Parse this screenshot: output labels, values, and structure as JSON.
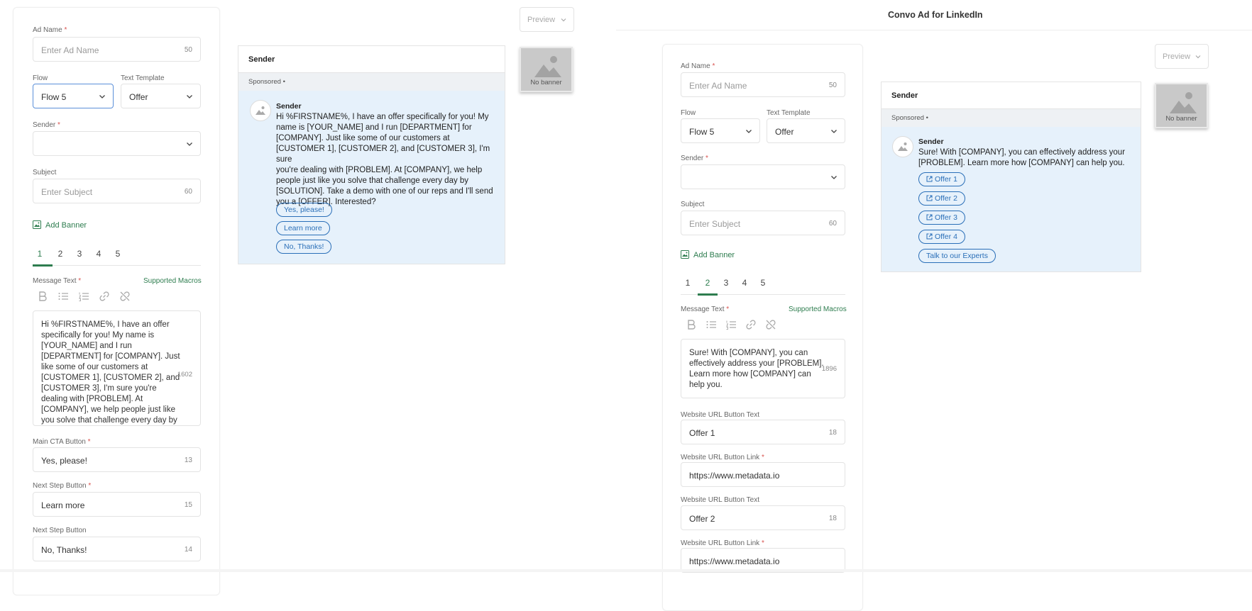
{
  "left_form": {
    "ad_name": {
      "label": "Ad Name",
      "required": "*",
      "placeholder": "Enter Ad Name",
      "count": "50"
    },
    "flow": {
      "label": "Flow",
      "value": "Flow 5"
    },
    "text_template": {
      "label": "Text Template",
      "value": "Offer"
    },
    "sender": {
      "label": "Sender",
      "required": "*",
      "value": ""
    },
    "subject": {
      "label": "Subject",
      "placeholder": "Enter Subject",
      "count": "60"
    },
    "add_banner": "Add Banner",
    "tabs": [
      "1",
      "2",
      "3",
      "4",
      "5"
    ],
    "active_tab": "1",
    "message_text": {
      "label": "Message Text",
      "required": "*",
      "macros": "Supported Macros",
      "count": "1602",
      "lines": [
        "Hi %FIRSTNAME%, I have an offer",
        "specifically for you! My name is",
        "[YOUR_NAME] and I run",
        "[DEPARTMENT] for [COMPANY]. Just",
        "like some of our customers at",
        "[CUSTOMER 1], [CUSTOMER 2], and",
        "[CUSTOMER 3], I'm sure you're",
        "dealing with [PROBLEM]. At",
        "[COMPANY], we help people just like",
        "you solve that challenge every day by"
      ]
    },
    "main_cta": {
      "label": "Main CTA Button",
      "required": "*",
      "value": "Yes, please!",
      "count": "13"
    },
    "next_step_1": {
      "label": "Next Step Button",
      "required": "*",
      "value": "Learn more",
      "count": "15"
    },
    "next_step_2": {
      "label": "Next Step Button",
      "value": "No, Thanks!",
      "count": "14"
    }
  },
  "left_preview": {
    "preview_label": "Preview",
    "sender_header": "Sender",
    "sponsored": "Sponsored •",
    "sender_name": "Sender",
    "message_lines": [
      "Hi %FIRSTNAME%, I have an offer specifically for you! My",
      "name is [YOUR_NAME] and I run [DEPARTMENT] for",
      "[COMPANY]. Just like some of our customers at",
      "[CUSTOMER 1], [CUSTOMER 2], and [CUSTOMER 3], I'm sure",
      "you're dealing with [PROBLEM]. At [COMPANY], we help",
      "people just like you solve that challenge every day by",
      "[SOLUTION]. Take a demo with one of our reps and I'll send",
      "you a [OFFER]. Interested?"
    ],
    "buttons": [
      "Yes, please!",
      "Learn more",
      "No, Thanks!"
    ],
    "banner_text": "No banner"
  },
  "right_title": "Convo Ad for LinkedIn",
  "right_form": {
    "ad_name": {
      "label": "Ad Name",
      "required": "*",
      "placeholder": "Enter Ad Name",
      "count": "50"
    },
    "flow": {
      "label": "Flow",
      "value": "Flow 5"
    },
    "text_template": {
      "label": "Text Template",
      "value": "Offer"
    },
    "sender": {
      "label": "Sender",
      "required": "*",
      "value": ""
    },
    "subject": {
      "label": "Subject",
      "placeholder": "Enter Subject",
      "count": "60"
    },
    "add_banner": "Add Banner",
    "tabs": [
      "1",
      "2",
      "3",
      "4",
      "5"
    ],
    "active_tab": "2",
    "message_text": {
      "label": "Message Text",
      "required": "*",
      "macros": "Supported Macros",
      "count": "1896",
      "lines": [
        "Sure! With [COMPANY], you can",
        "effectively address your [PROBLEM].",
        "Learn more how [COMPANY] can",
        "help you."
      ]
    },
    "url_text_1": {
      "label": "Website URL Button Text",
      "value": "Offer 1",
      "count": "18"
    },
    "url_link_1": {
      "label": "Website URL Button Link",
      "required": "*",
      "value": "https://www.metadata.io"
    },
    "url_text_2": {
      "label": "Website URL Button Text",
      "value": "Offer 2",
      "count": "18"
    },
    "url_link_2": {
      "label": "Website URL Button Link",
      "required": "*",
      "value": "https://www.metadata.io"
    }
  },
  "right_preview": {
    "preview_label": "Preview",
    "sender_header": "Sender",
    "sponsored": "Sponsored •",
    "sender_name": "Sender",
    "message_lines": [
      "Sure! With [COMPANY], you can effectively address your",
      "[PROBLEM]. Learn more how [COMPANY] can help you."
    ],
    "buttons": [
      "Offer 1",
      "Offer 2",
      "Offer 3",
      "Offer 4",
      "Talk to our Experts"
    ],
    "banner_text": "No banner"
  },
  "colors": {
    "accent_green": "#2e7d4f",
    "link_blue": "#2a6fb8",
    "preview_bg": "#e6f1fb",
    "required_red": "#d9534f"
  }
}
